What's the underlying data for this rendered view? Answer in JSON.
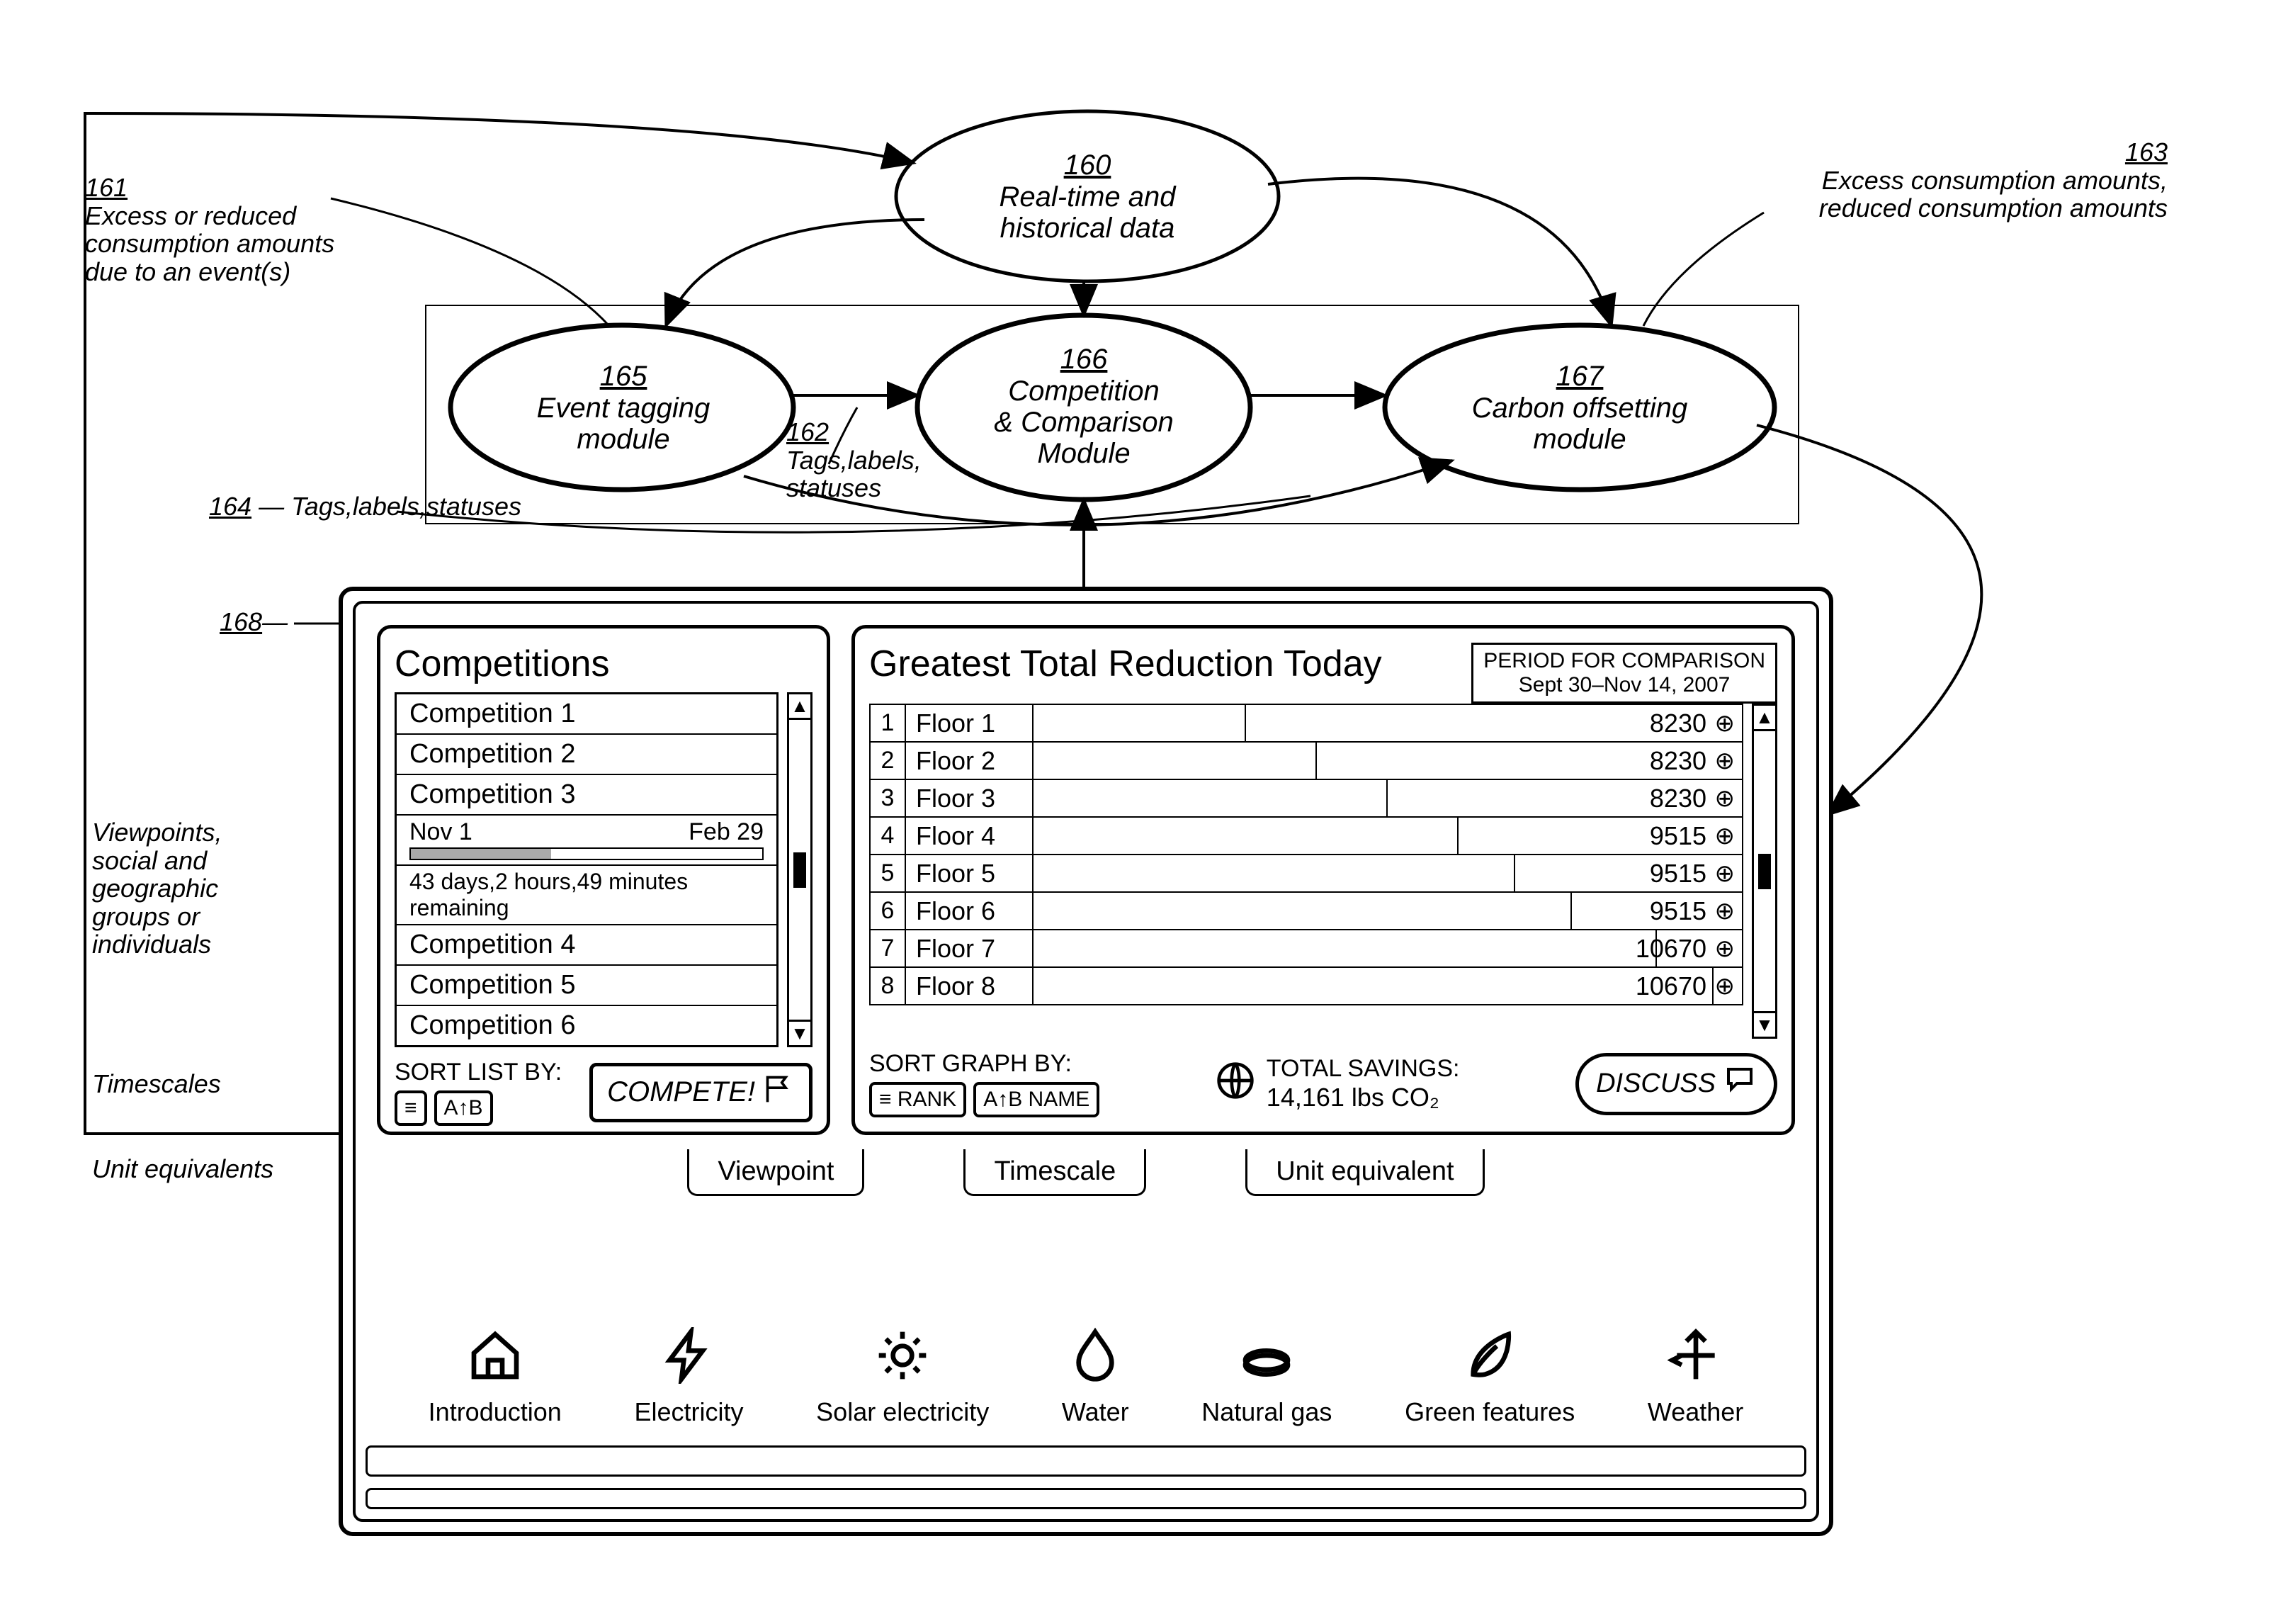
{
  "nodes": {
    "n160": {
      "ref": "160",
      "label": "Real-time and\nhistorical data"
    },
    "n165": {
      "ref": "165",
      "label": "Event tagging\nmodule"
    },
    "n166": {
      "ref": "166",
      "label": "Competition\n& Comparison\nModule"
    },
    "n167": {
      "ref": "167",
      "label": "Carbon offsetting\nmodule"
    }
  },
  "annotations": {
    "a161": {
      "ref": "161",
      "text": "Excess or reduced\nconsumption amounts\ndue to an event(s)"
    },
    "a162": {
      "ref": "162",
      "text": "Tags,labels,\nstatuses"
    },
    "a163": {
      "ref": "163",
      "text": "Excess consumption amounts,\nreduced consumption amounts"
    },
    "a164": {
      "ref": "164",
      "text": "Tags,labels,statuses"
    },
    "a168": {
      "ref": "168",
      "text": ""
    },
    "side1": "Viewpoints,\nsocial and\ngeographic\ngroups or\nindividuals",
    "side2": "Timescales",
    "side3": "Unit equivalents"
  },
  "dashboard": {
    "competitions": {
      "title": "Competitions",
      "items": [
        "Competition 1",
        "Competition 2",
        "Competition 3",
        "Competition 4",
        "Competition 5",
        "Competition 6"
      ],
      "timeline": {
        "start": "Nov 1",
        "end": "Feb 29"
      },
      "remaining": "43 days,2 hours,49 minutes remaining",
      "sort_label": "SORT LIST BY:",
      "btn_lines": "≡",
      "btn_az": "A↑B",
      "compete_label": "COMPETE!"
    },
    "reduction": {
      "title": "Greatest Total Reduction Today",
      "period_heading": "PERIOD FOR COMPARISON",
      "period_value": "Sept 30–Nov 14, 2007",
      "rows": [
        {
          "idx": "1",
          "name": "Floor 1",
          "value": "8230",
          "bar_pct": 30
        },
        {
          "idx": "2",
          "name": "Floor 2",
          "value": "8230",
          "bar_pct": 40
        },
        {
          "idx": "3",
          "name": "Floor 3",
          "value": "8230",
          "bar_pct": 50
        },
        {
          "idx": "4",
          "name": "Floor 4",
          "value": "9515",
          "bar_pct": 60
        },
        {
          "idx": "5",
          "name": "Floor 5",
          "value": "9515",
          "bar_pct": 68
        },
        {
          "idx": "6",
          "name": "Floor 6",
          "value": "9515",
          "bar_pct": 76
        },
        {
          "idx": "7",
          "name": "Floor 7",
          "value": "10670",
          "bar_pct": 88
        },
        {
          "idx": "8",
          "name": "Floor 8",
          "value": "10670",
          "bar_pct": 96
        }
      ],
      "sort_label": "SORT GRAPH BY:",
      "btn_rank": "≡ RANK",
      "btn_name": "A↑B NAME",
      "savings_heading": "TOTAL SAVINGS:",
      "savings_value": "14,161 lbs CO₂",
      "discuss_label": "DISCUSS"
    },
    "tabs": [
      "Viewpoint",
      "Timescale",
      "Unit equivalent"
    ],
    "nav": [
      {
        "label": "Introduction",
        "icon": "house"
      },
      {
        "label": "Electricity",
        "icon": "bolt"
      },
      {
        "label": "Solar electricity",
        "icon": "sun"
      },
      {
        "label": "Water",
        "icon": "drop"
      },
      {
        "label": "Natural gas",
        "icon": "burner"
      },
      {
        "label": "Green features",
        "icon": "leaf"
      },
      {
        "label": "Weather",
        "icon": "vane"
      }
    ]
  }
}
